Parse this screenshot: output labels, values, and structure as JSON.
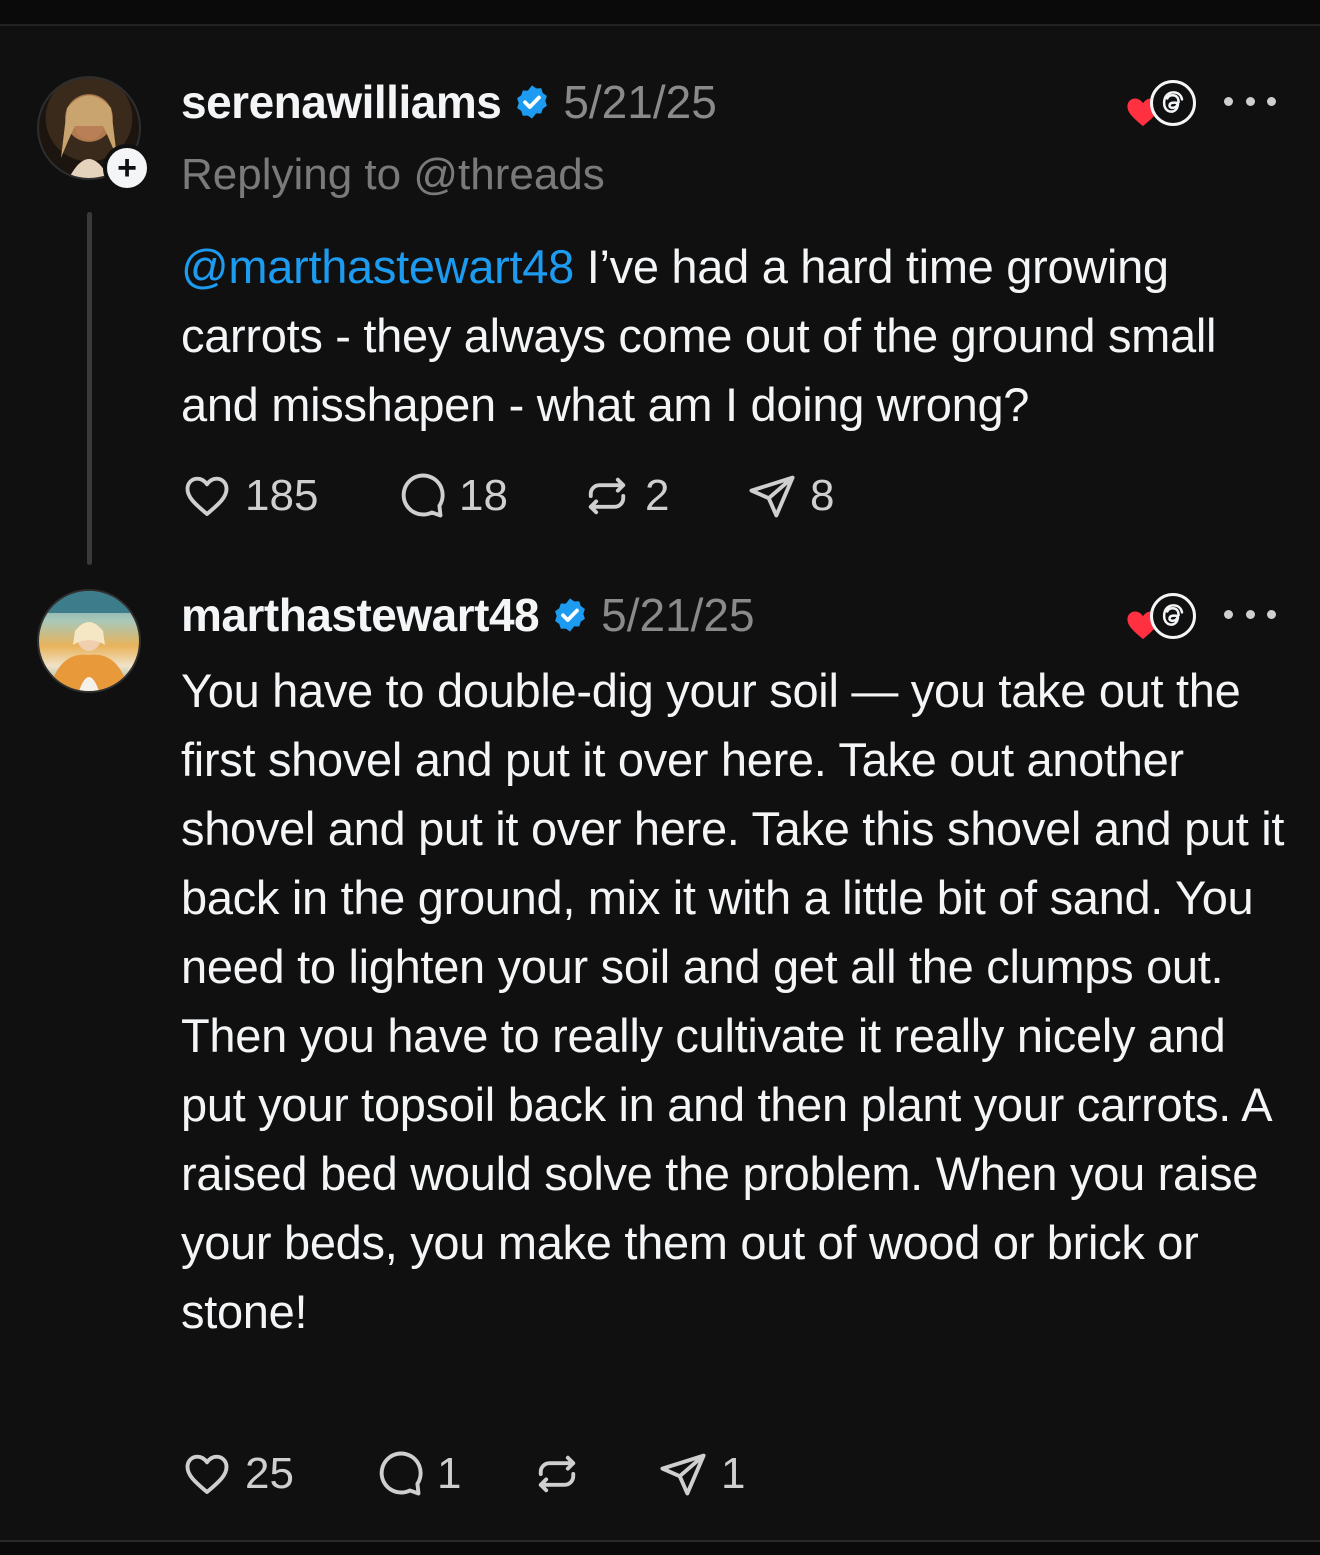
{
  "posts": [
    {
      "username": "serenawilliams",
      "date": "5/21/25",
      "replying_to": "Replying to @threads",
      "mention": "@marthastewart48",
      "text": " I’ve had a hard time growing carrots - they always come out of the ground small and misshapen - what am I doing wrong?",
      "likes": "185",
      "replies": "18",
      "reposts": "2",
      "shares": "8"
    },
    {
      "username": "marthastewart48",
      "date": "5/21/25",
      "text": "You have to double-dig your soil — you take out the first shovel and put it over here. Take out another shovel and put it over here. Take this shovel and put it back in the ground, mix it with a little bit of sand. You need to lighten your soil and get all the clumps out. Then you have to really cultivate it really nicely and put your topsoil back in and then plant your carrots. A raised bed would solve the problem. When you raise your beds, you make them out of wood or brick or stone!",
      "likes": "25",
      "replies": "1",
      "shares": "1"
    }
  ],
  "colors": {
    "background": "#101010",
    "text": "#f3f5f7",
    "muted": "#8a8a8a",
    "mention": "#1d9bf0",
    "verified": "#1d9bf0",
    "heart": "#ff3040"
  },
  "icons": {
    "avatar_action": "plus-icon",
    "verified": "verified-badge-icon",
    "liked_badge": "heart-icon",
    "app_badge": "threads-logo-icon",
    "more": "more-horizontal-icon",
    "like": "heart-outline-icon",
    "reply": "comment-icon",
    "repost": "repost-icon",
    "share": "send-icon"
  }
}
